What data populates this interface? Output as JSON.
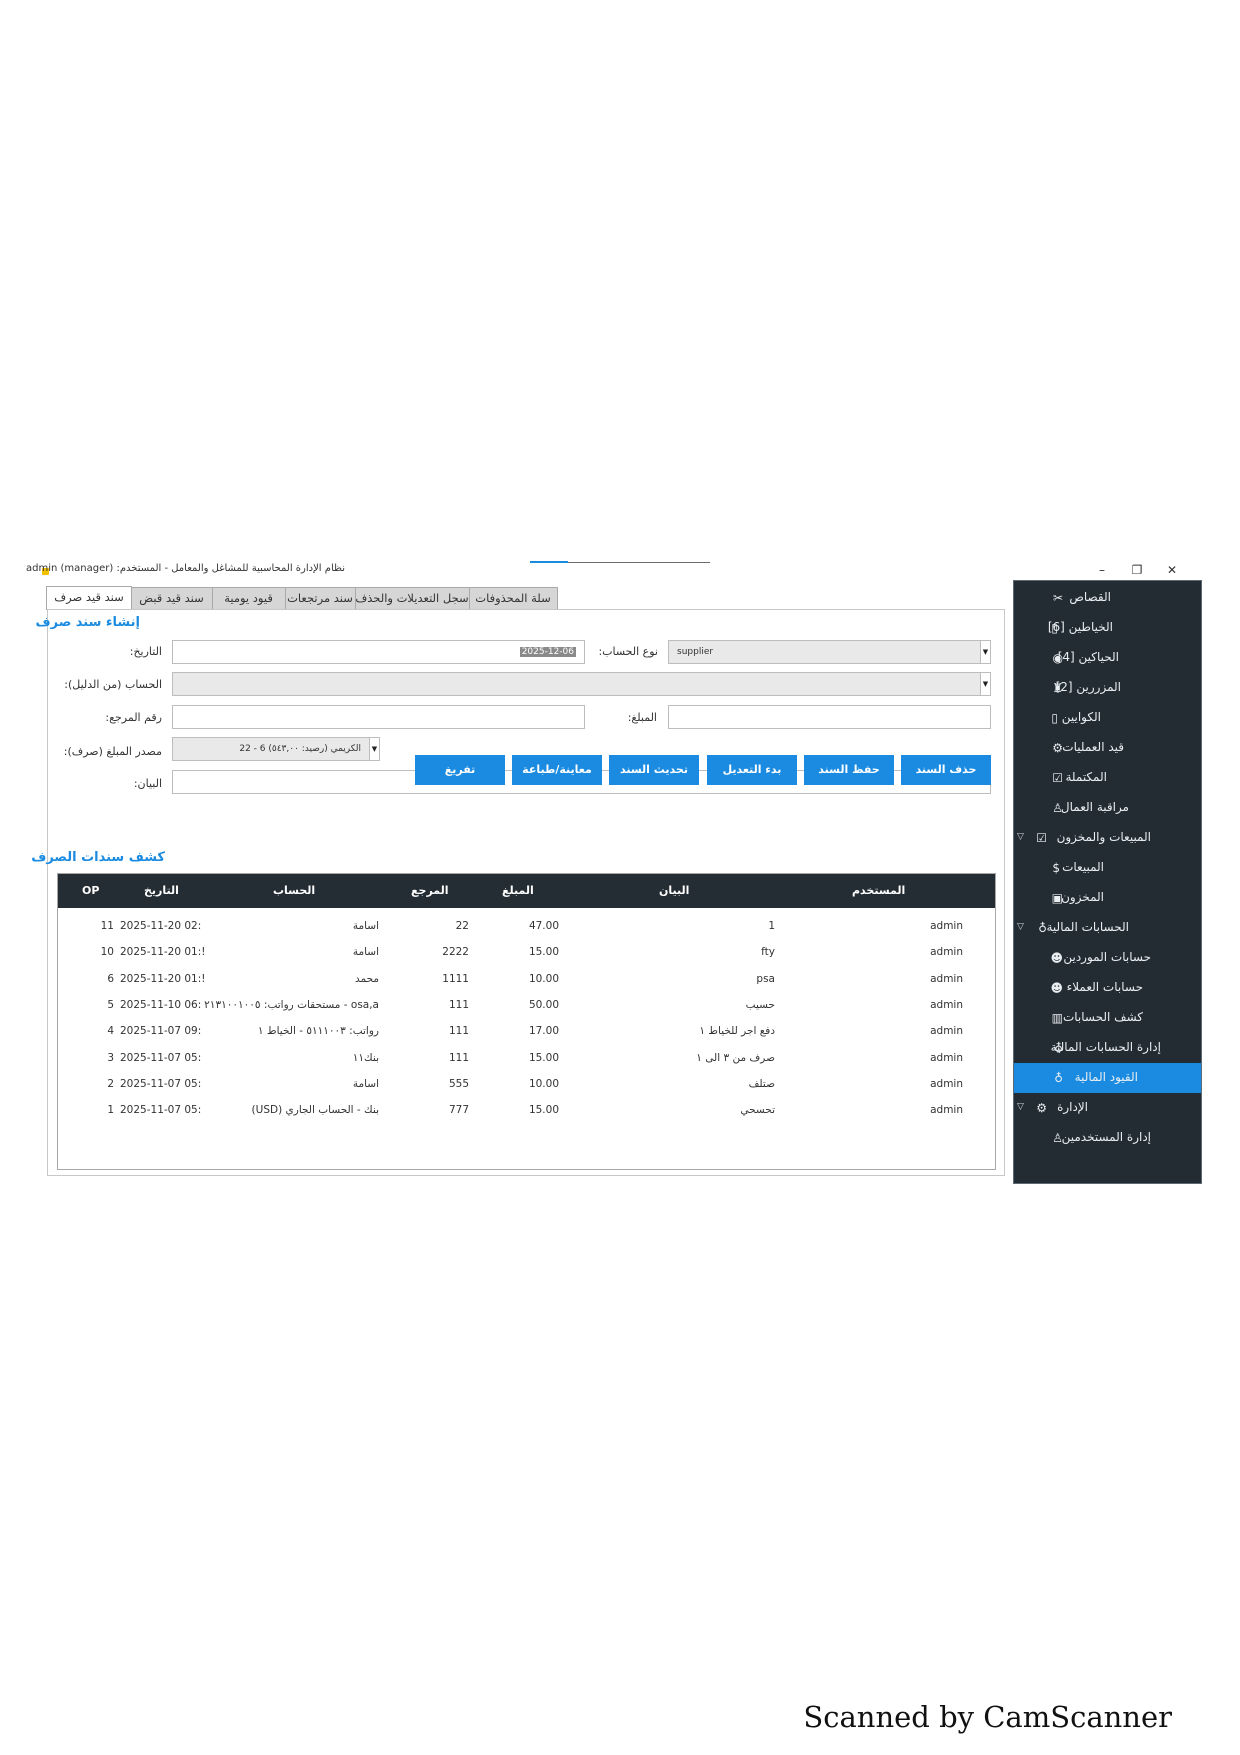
{
  "window": {
    "title": "نظام الإدارة المحاسبية للمشاغل والمعامل - المستخدم: admin (manager)",
    "controls": [
      "–",
      "❐",
      "✕"
    ]
  },
  "sidebar": {
    "items": [
      {
        "label": "القصاص",
        "icon": "scissors-icon",
        "glyph": "✂"
      },
      {
        "label": "الخياطين [6]",
        "icon": "square-icon",
        "glyph": "▯"
      },
      {
        "label": "الحياكين [4]",
        "icon": "palette-icon",
        "glyph": "◉"
      },
      {
        "label": "المزررين [2]",
        "icon": "machine-icon",
        "glyph": "♜"
      },
      {
        "label": "الكوايين",
        "icon": "square-icon",
        "glyph": "▯"
      },
      {
        "label": "قيد العمليات",
        "icon": "gear-icon",
        "glyph": "⚙"
      },
      {
        "label": "المكتملة",
        "icon": "check-icon",
        "glyph": "☑"
      },
      {
        "label": "مراقبة العمال",
        "icon": "worker-icon",
        "glyph": "♙"
      },
      {
        "label": "المبيعات والمخزون",
        "icon": "checkbox-icon",
        "glyph": "☑",
        "group": true
      },
      {
        "label": "المبيعات",
        "icon": "dollar-icon",
        "glyph": "$"
      },
      {
        "label": "المخزون",
        "icon": "box-icon",
        "glyph": "▣"
      },
      {
        "label": "الحسابات المالية",
        "icon": "moneybag-icon",
        "glyph": "♁",
        "group": true
      },
      {
        "label": "حسابات الموردين",
        "icon": "people-icon",
        "glyph": "☻"
      },
      {
        "label": "حسابات العملاء",
        "icon": "people-icon",
        "glyph": "☻"
      },
      {
        "label": "كشف الحسابات",
        "icon": "chart-icon",
        "glyph": "▥"
      },
      {
        "label": "إدارة الحسابات المالية",
        "icon": "moneybag-icon",
        "glyph": "♁"
      },
      {
        "label": "القيود المالية",
        "icon": "moneybag-icon",
        "glyph": "♁",
        "active": true
      },
      {
        "label": "الإدارة",
        "icon": "gear-icon",
        "glyph": "⚙",
        "group": true
      },
      {
        "label": "إدارة المستخدمين",
        "icon": "user-icon",
        "glyph": "♙"
      }
    ]
  },
  "tabs": [
    "سند قيد صرف",
    "سند قيد قبض",
    "قيود يومية",
    "سند مرتجعات",
    "سجل التعديلات والحذف",
    "سلة المحذوفات"
  ],
  "form": {
    "title": "إنشاء سند صرف",
    "date_label": "التاريخ:",
    "date_value": "2025-12-06",
    "account_type_label": "نوع الحساب:",
    "account_type_value": "supplier",
    "account_label": "الحساب (من الدليل):",
    "ref_label": "رقم المرجع:",
    "amount_label": "المبلغ:",
    "source_label": "مصدر المبلغ (صرف):",
    "source_value": "22 - 6 الكريمي (رصيد: ٥٤٣,٠٠)",
    "desc_label": "البيان:"
  },
  "buttons": [
    "حذف السند",
    "حفظ السند",
    "بدء التعديل",
    "تحديث السند",
    "معاينة/طباعة",
    "تفريغ"
  ],
  "table": {
    "title": "كشف سندات الصرف",
    "columns": [
      "OP",
      "التاريخ",
      "الحساب",
      "المرجع",
      "المبلغ",
      "البيان",
      "المستخدم"
    ],
    "rows": [
      [
        "11",
        "2025-11-20 02:",
        "اسامة",
        "22",
        "47.00",
        "1",
        "admin"
      ],
      [
        "10",
        "2025-11-20 01:!",
        "اسامة",
        "2222",
        "15.00",
        "fty",
        "admin"
      ],
      [
        "6",
        "2025-11-20 01:!",
        "محمد",
        "1111",
        "10.00",
        "psa",
        "admin"
      ],
      [
        "5",
        "2025-11-10 06:",
        "osa,a - مستحقات رواتب: ٢١٣١٠٠١٠٠٥",
        "111",
        "50.00",
        "حسيب",
        "admin"
      ],
      [
        "4",
        "2025-11-07 09:",
        "رواتب: ٥١١١٠٠٣ - الخياط ١",
        "111",
        "17.00",
        "دفع اجر للخياط ١",
        "admin"
      ],
      [
        "3",
        "2025-11-07 05:",
        "بنك١١",
        "111",
        "15.00",
        "صرف من ٣ الى ١",
        "admin"
      ],
      [
        "2",
        "2025-11-07 05:",
        "اسامة",
        "555",
        "10.00",
        "صتلف",
        "admin"
      ],
      [
        "1",
        "2025-11-07 05:",
        "بنك - الحساب الجاري (USD)",
        "777",
        "15.00",
        "تحسحي",
        "admin"
      ]
    ]
  },
  "footer": "Scanned by CamScanner"
}
